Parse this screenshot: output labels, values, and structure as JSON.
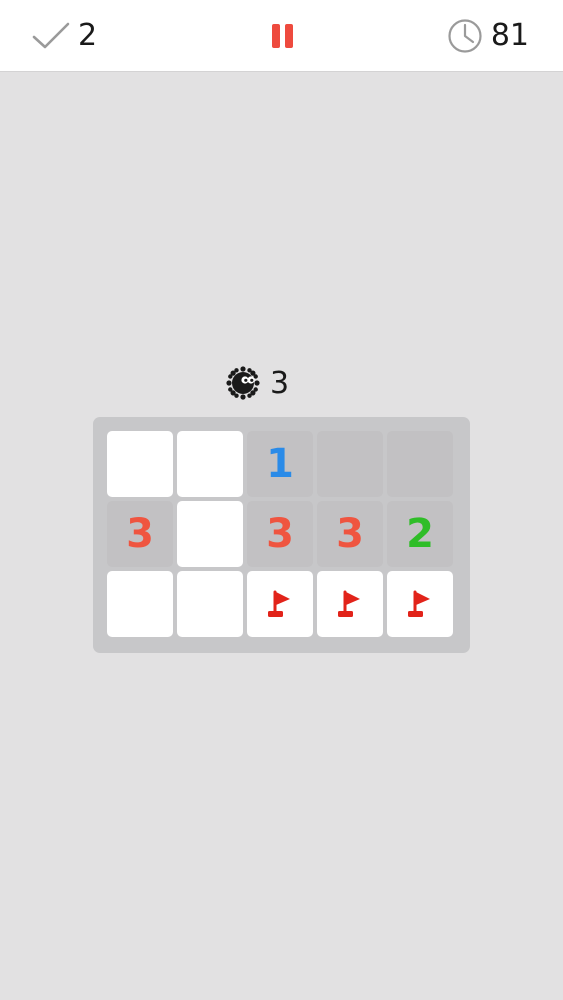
{
  "header": {
    "solved_count": "2",
    "timer": "81",
    "pause_label": "Pause"
  },
  "mine_counter": {
    "value": "3"
  },
  "board": {
    "rows": 3,
    "cols": 5,
    "cells": [
      [
        {
          "state": "covered",
          "label": ""
        },
        {
          "state": "covered",
          "label": ""
        },
        {
          "state": "revealed",
          "label": "1"
        },
        {
          "state": "revealed",
          "label": ""
        },
        {
          "state": "revealed",
          "label": ""
        }
      ],
      [
        {
          "state": "revealed",
          "label": "3"
        },
        {
          "state": "covered",
          "label": ""
        },
        {
          "state": "revealed",
          "label": "3"
        },
        {
          "state": "revealed",
          "label": "3"
        },
        {
          "state": "revealed",
          "label": "2"
        }
      ],
      [
        {
          "state": "covered",
          "label": ""
        },
        {
          "state": "covered",
          "label": ""
        },
        {
          "state": "flagged",
          "label": ""
        },
        {
          "state": "flagged",
          "label": ""
        },
        {
          "state": "flagged",
          "label": ""
        }
      ]
    ]
  },
  "colors": {
    "background": "#e2e1e2",
    "accent_red": "#ee4a3e",
    "number_1": "#2a8be8",
    "number_2": "#2fbd28",
    "number_3": "#ef5540"
  },
  "icons": {
    "solved": "checkmark-icon",
    "pause": "pause-icon",
    "timer": "clock-icon",
    "mine": "mine-icon",
    "flag": "flag-icon"
  }
}
